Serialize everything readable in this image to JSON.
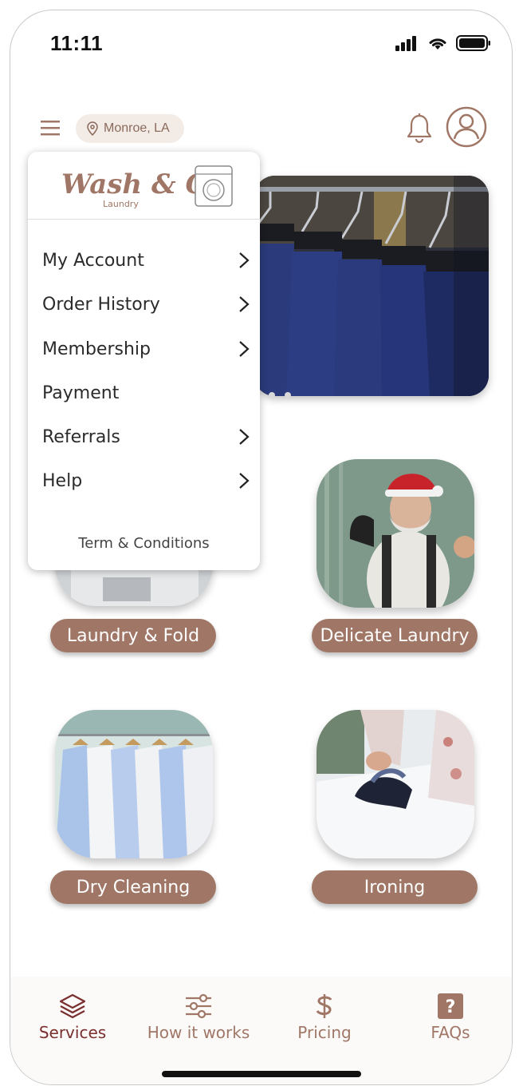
{
  "status_bar": {
    "time": "11:11"
  },
  "header": {
    "location": "Monroe, LA"
  },
  "menu": {
    "logo": "Wash & GO Laundry",
    "items": [
      {
        "label": "My Account",
        "has_chevron": true
      },
      {
        "label": "Order History",
        "has_chevron": true
      },
      {
        "label": "Membership",
        "has_chevron": true
      },
      {
        "label": "Payment",
        "has_chevron": false
      },
      {
        "label": "Referrals",
        "has_chevron": true
      },
      {
        "label": "Help",
        "has_chevron": true
      }
    ],
    "terms": "Term & Conditions"
  },
  "services": [
    {
      "label": "Laundry & Fold"
    },
    {
      "label": "Delicate Laundry"
    },
    {
      "label": "Dry Cleaning"
    },
    {
      "label": "Ironing"
    }
  ],
  "bottom_nav": [
    {
      "label": "Services",
      "icon": "layers-icon",
      "active": true
    },
    {
      "label": "How it works",
      "icon": "sliders-icon"
    },
    {
      "label": "Pricing",
      "icon": "dollar-icon"
    },
    {
      "label": "FAQs",
      "icon": "question-icon"
    }
  ],
  "colors": {
    "accent": "#a07766",
    "pill_bg": "#f3ebe6",
    "active_nav": "#7a2f2f"
  }
}
